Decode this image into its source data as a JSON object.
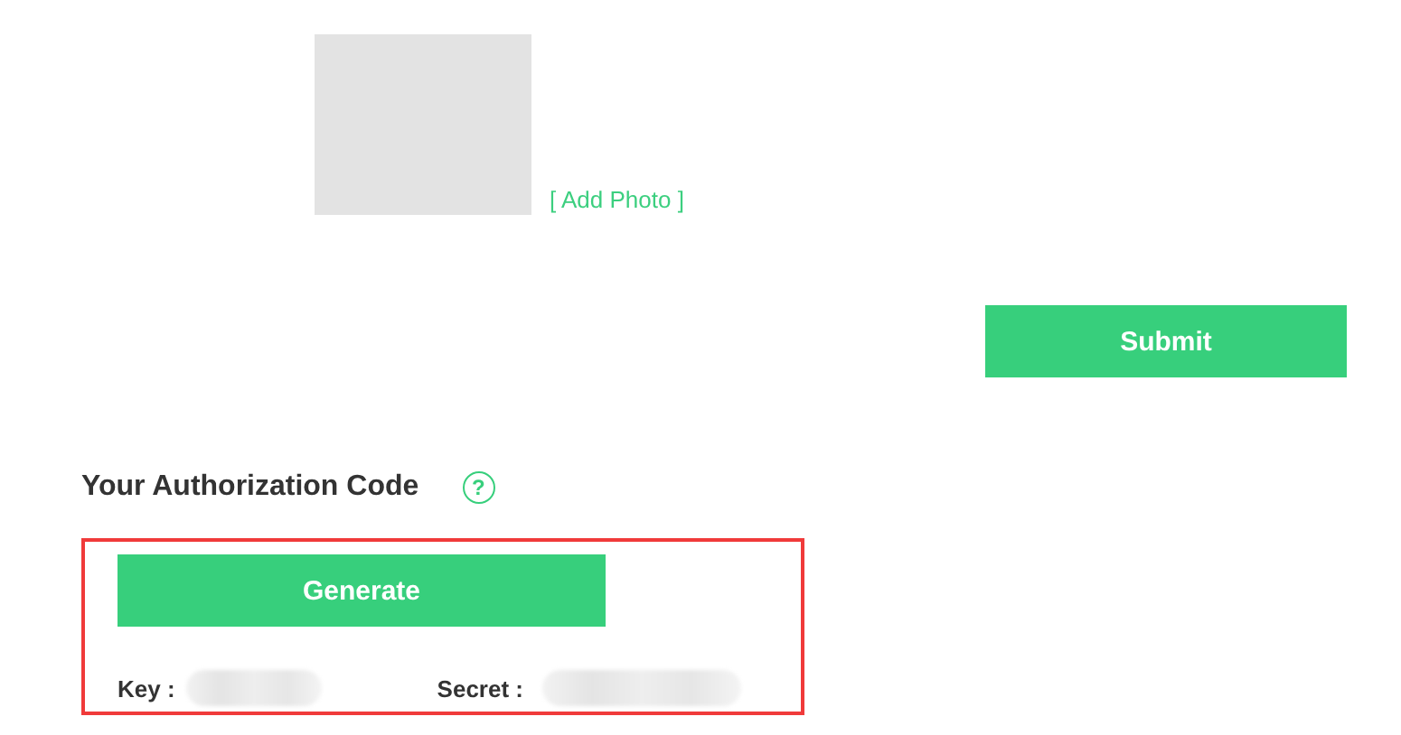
{
  "photo": {
    "link": "[ Add Photo ]"
  },
  "submit_button": "Submit",
  "authorization": {
    "title": "Your Authorization Code",
    "help_icon": "?",
    "generate_button": "Generate",
    "fields": [
      {
        "label": "Key :"
      },
      {
        "label": "Secret :"
      }
    ]
  }
}
